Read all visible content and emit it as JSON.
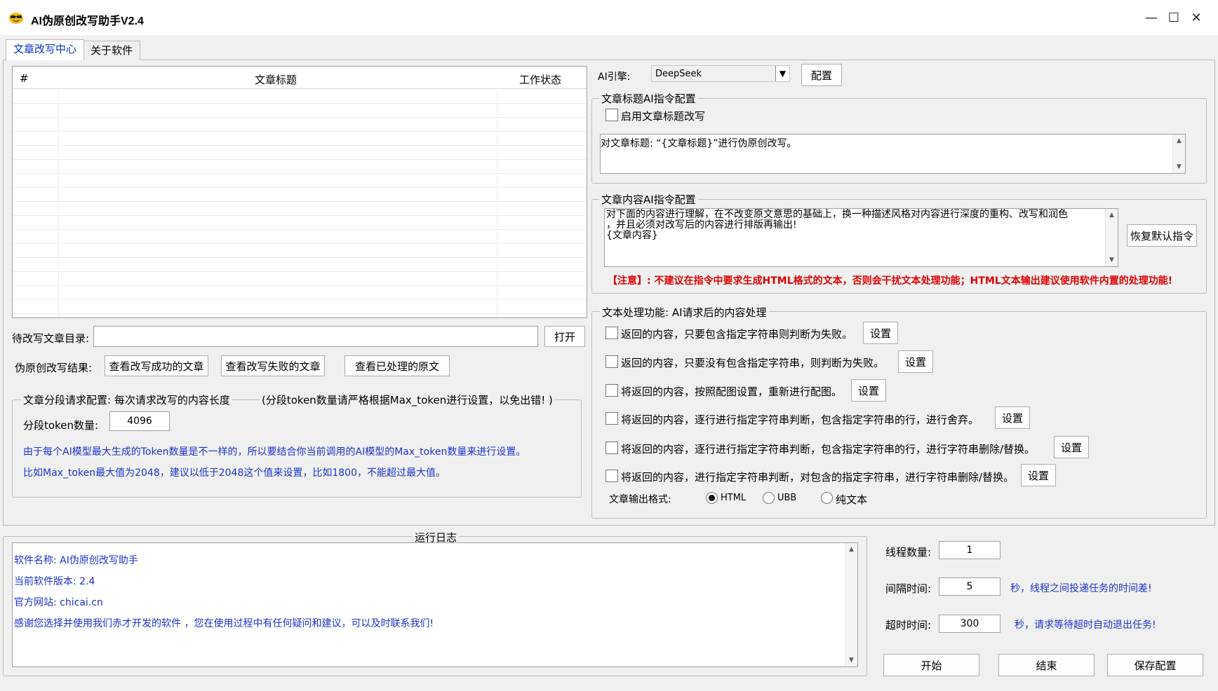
{
  "window": {
    "title": "AI伪原创改写助手V2.4",
    "minimize": "—",
    "maximize": "☐",
    "close": "✕"
  },
  "tabs": [
    {
      "label": "文章改写中心",
      "active": true
    },
    {
      "label": "关于软件",
      "active": false
    }
  ],
  "table": {
    "columns": [
      "#",
      "文章标题",
      "工作状态"
    ],
    "rows": []
  },
  "directory": {
    "label": "待改写文章目录:",
    "value": "",
    "open_button": "打开"
  },
  "results": {
    "label": "伪原创改写结果:",
    "view_success": "查看改写成功的文章",
    "view_failed": "查看改写失败的文章",
    "view_processed": "查看已处理的原文"
  },
  "segment": {
    "legend": "文章分段请求配置: 每次请求改写的内容长度",
    "note": "(分段token数量请严格根据Max_token进行设置，以免出错! )",
    "token_label": "分段token数量:",
    "token_value": "4096",
    "info1": "由于每个AI模型最大生成的Token数量是不一样的，所以要结合你当前调用的AI模型的Max_token数量来进行设置。",
    "info2": "比如Max_token最大值为2048，建议以低于2048这个值来设置，比如1800，不能超过最大值。"
  },
  "engine": {
    "label": "AI引擎:",
    "selected": "DeepSeek",
    "config_button": "配置"
  },
  "title_prompt": {
    "legend": "文章标题AI指令配置",
    "enable_label": "启用文章标题改写",
    "enabled": false,
    "text": "对文章标题: “{文章标题}”进行伪原创改写。"
  },
  "content_prompt": {
    "legend": "文章内容AI指令配置",
    "text_line1": "对下面的内容进行理解，在不改变原文意思的基础上，换一种描述风格对内容进行深度的重构、改写和润色",
    "text_line2": "，并且必须对改写后的内容进行排版再输出!",
    "text_line3": "{文章内容}",
    "restore_button": "恢复默认指令",
    "warning": "【注意】: 不建议在指令中要求生成HTML格式的文本，否则会干扰文本处理功能；HTML文本输出建议使用软件内置的处理功能!"
  },
  "processing": {
    "legend": "文本处理功能: AI请求后的内容处理",
    "options": [
      {
        "label": "返回的内容，只要包含指定字符串则判断为失败。",
        "button": "设置"
      },
      {
        "label": "返回的内容，只要没有包含指定字符串，则判断为失败。",
        "button": "设置"
      },
      {
        "label": "将返回的内容，按照配图设置，重新进行配图。",
        "button": "设置"
      },
      {
        "label": "将返回的内容，逐行进行指定字符串判断，包含指定字符串的行，进行舍弃。",
        "button": "设置"
      },
      {
        "label": "将返回的内容，逐行进行指定字符串判断，包含指定字符串的行，进行字符串删除/替换。",
        "button": "设置"
      },
      {
        "label": "将返回的内容，进行指定字符串判断，对包含的指定字符串，进行字符串删除/替换。",
        "button": "设置"
      }
    ],
    "format_label": "文章输出格式:",
    "formats": [
      {
        "label": "HTML",
        "selected": true
      },
      {
        "label": "UBB",
        "selected": false
      },
      {
        "label": "纯文本",
        "selected": false
      }
    ]
  },
  "log": {
    "title": "运行日志",
    "lines": [
      "软件名称: AI伪原创改写助手",
      "当前软件版本: 2.4",
      "官方网站: chicai.cn",
      "感谢您选择并使用我们赤才开发的软件 ，您在使用过程中有任何疑问和建议，可以及时联系我们!"
    ]
  },
  "settings": {
    "threads_label": "线程数量:",
    "threads_value": "1",
    "interval_label": "间隔时间:",
    "interval_value": "5",
    "interval_note": "秒，线程之间投递任务的时间差!",
    "timeout_label": "超时时间:",
    "timeout_value": "300",
    "timeout_note": "秒，请求等待超时自动退出任务!"
  },
  "actions": {
    "start": "开始",
    "stop": "结束",
    "save": "保存配置"
  }
}
